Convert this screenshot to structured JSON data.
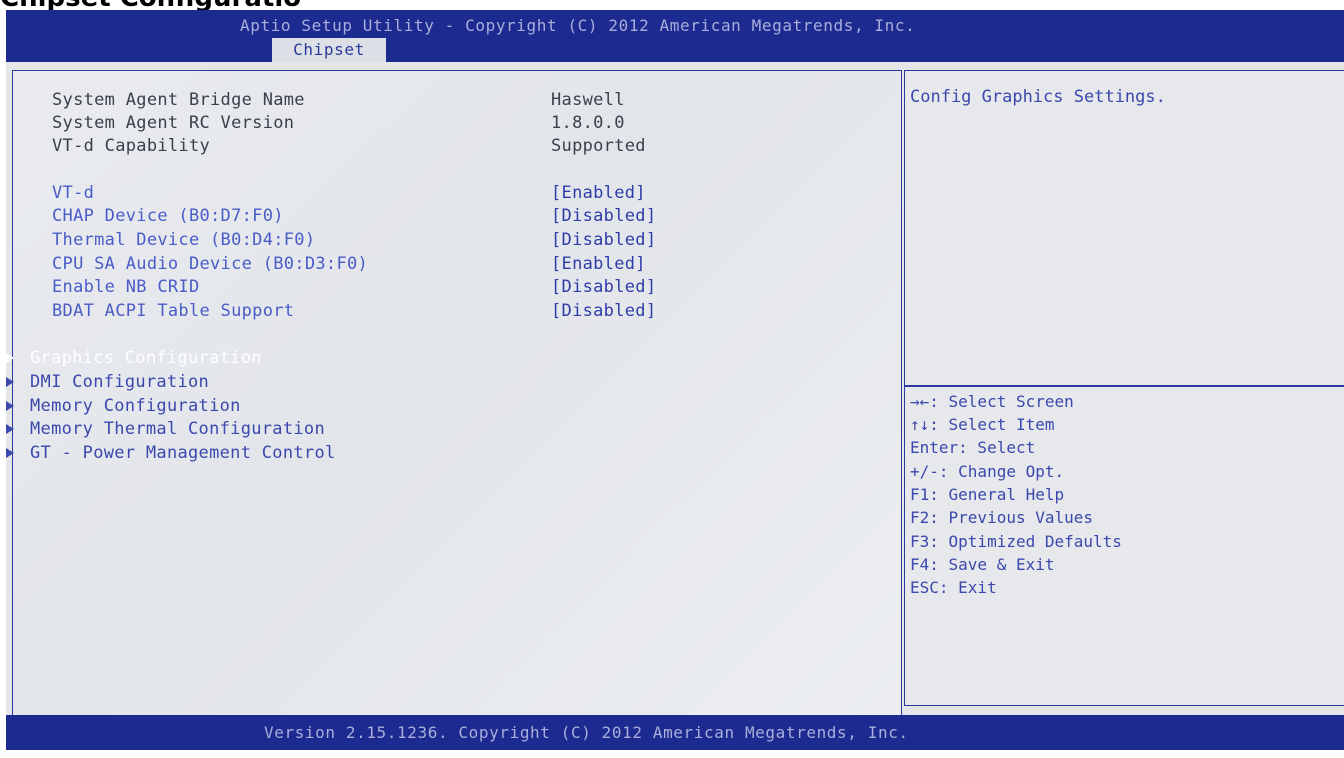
{
  "page_title_fragment": "Chipset Configuration",
  "header": {
    "title": "Aptio Setup Utility - Copyright (C) 2012 American Megatrends, Inc.",
    "active_tab": "Chipset"
  },
  "info_items": [
    {
      "label": "System Agent Bridge Name",
      "value": "Haswell"
    },
    {
      "label": "System Agent RC Version",
      "value": "1.8.0.0"
    },
    {
      "label": "VT-d Capability",
      "value": "Supported"
    }
  ],
  "options": [
    {
      "label": "VT-d",
      "value": "[Enabled]"
    },
    {
      "label": "CHAP Device (B0:D7:F0)",
      "value": "[Disabled]"
    },
    {
      "label": "Thermal Device (B0:D4:F0)",
      "value": "[Disabled]"
    },
    {
      "label": "CPU SA Audio Device (B0:D3:F0)",
      "value": "[Enabled]"
    },
    {
      "label": "Enable NB CRID",
      "value": "[Disabled]"
    },
    {
      "label": "BDAT ACPI Table Support",
      "value": "[Disabled]"
    }
  ],
  "submenus": [
    {
      "label": "Graphics Configuration",
      "selected": true
    },
    {
      "label": "DMI Configuration",
      "selected": false
    },
    {
      "label": "Memory Configuration",
      "selected": false
    },
    {
      "label": "Memory Thermal Configuration",
      "selected": false
    },
    {
      "label": "GT - Power Management Control",
      "selected": false
    }
  ],
  "help": {
    "description": "Config Graphics Settings.",
    "keys": [
      "→←: Select Screen",
      "↑↓: Select Item",
      "Enter: Select",
      "+/-: Change Opt.",
      "F1: General Help",
      "F2: Previous Values",
      "F3: Optimized Defaults",
      "F4: Save & Exit",
      "ESC: Exit"
    ]
  },
  "footer": {
    "text": "Version 2.15.1236. Copyright (C) 2012 American Megatrends, Inc."
  },
  "colors": {
    "bar_blue": "#1d2a90",
    "panel_bg": "#e4e6ea",
    "highlight_text": "#3b48ad",
    "selected_text": "#ffffff"
  }
}
